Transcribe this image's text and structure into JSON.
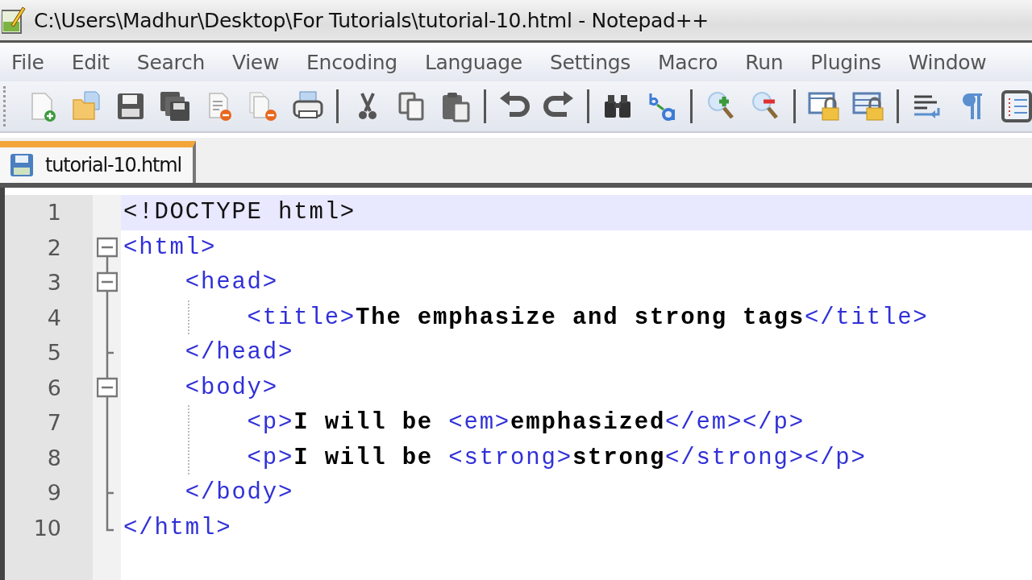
{
  "window": {
    "title": "C:\\Users\\Madhur\\Desktop\\For Tutorials\\tutorial-10.html - Notepad++"
  },
  "menu": [
    "File",
    "Edit",
    "Search",
    "View",
    "Encoding",
    "Language",
    "Settings",
    "Macro",
    "Run",
    "Plugins",
    "Window"
  ],
  "tabs": [
    {
      "label": "tutorial-10.html",
      "selected": true
    }
  ],
  "editor": {
    "lines": [
      {
        "number": "1",
        "current": true,
        "kind": "plain",
        "tokens": [
          {
            "kind": "plain",
            "text": "<!DOCTYPE html>"
          }
        ]
      },
      {
        "number": "2",
        "current": false,
        "kind": "foldstart",
        "tokens": [
          {
            "kind": "tag",
            "text": "<html>"
          }
        ]
      },
      {
        "number": "3",
        "current": false,
        "kind": "foldstart",
        "tokens": [
          {
            "kind": "tag",
            "text": "    <head>"
          }
        ]
      },
      {
        "number": "4",
        "current": false,
        "kind": "foldline",
        "tokens": [
          {
            "kind": "tag",
            "text": "        <title>"
          },
          {
            "kind": "text",
            "text": "The emphasize and strong tags"
          },
          {
            "kind": "tag",
            "text": "</title>"
          }
        ]
      },
      {
        "number": "5",
        "current": false,
        "kind": "foldbranch",
        "tokens": [
          {
            "kind": "tag",
            "text": "    </head>"
          }
        ]
      },
      {
        "number": "6",
        "current": false,
        "kind": "foldstart",
        "tokens": [
          {
            "kind": "tag",
            "text": "    <body>"
          }
        ]
      },
      {
        "number": "7",
        "current": false,
        "kind": "foldline",
        "tokens": [
          {
            "kind": "tag",
            "text": "        <p>"
          },
          {
            "kind": "text",
            "text": "I will be "
          },
          {
            "kind": "tag",
            "text": "<em>"
          },
          {
            "kind": "text",
            "text": "emphasized"
          },
          {
            "kind": "tag",
            "text": "</em></p>"
          }
        ]
      },
      {
        "number": "8",
        "current": false,
        "kind": "foldline",
        "tokens": [
          {
            "kind": "tag",
            "text": "        <p>"
          },
          {
            "kind": "text",
            "text": "I will be "
          },
          {
            "kind": "tag",
            "text": "<strong>"
          },
          {
            "kind": "text",
            "text": "strong"
          },
          {
            "kind": "tag",
            "text": "</strong></p>"
          }
        ]
      },
      {
        "number": "9",
        "current": false,
        "kind": "foldbranch",
        "tokens": [
          {
            "kind": "tag",
            "text": "    </body>"
          }
        ]
      },
      {
        "number": "10",
        "current": false,
        "kind": "foldend",
        "tokens": [
          {
            "kind": "tag",
            "text": "</html>"
          }
        ]
      }
    ]
  }
}
